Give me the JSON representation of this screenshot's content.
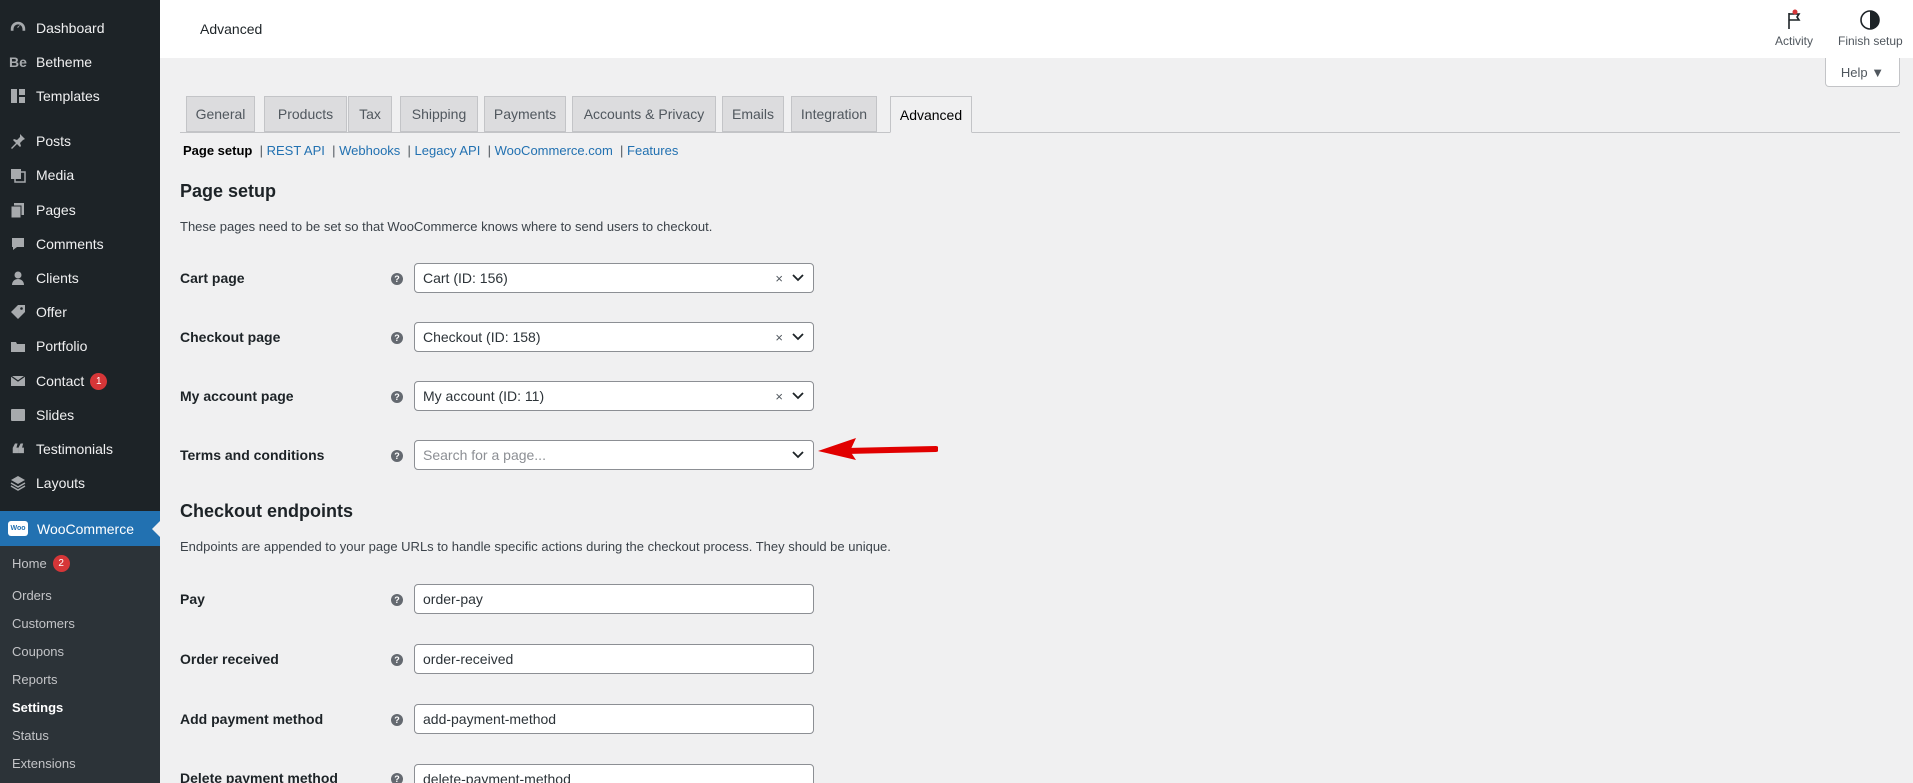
{
  "sidebar": {
    "items": [
      {
        "label": "Dashboard",
        "icon": "dashboard-icon"
      },
      {
        "label": "Betheme",
        "icon": "betheme-icon"
      },
      {
        "label": "Templates",
        "icon": "templates-icon"
      },
      {
        "label": "Posts",
        "icon": "pin-icon"
      },
      {
        "label": "Media",
        "icon": "media-icon"
      },
      {
        "label": "Pages",
        "icon": "pages-icon"
      },
      {
        "label": "Comments",
        "icon": "comments-icon"
      },
      {
        "label": "Clients",
        "icon": "clients-icon"
      },
      {
        "label": "Offer",
        "icon": "tag-icon"
      },
      {
        "label": "Portfolio",
        "icon": "portfolio-icon"
      },
      {
        "label": "Contact",
        "icon": "mail-icon",
        "badge": "1"
      },
      {
        "label": "Slides",
        "icon": "slides-icon"
      },
      {
        "label": "Testimonials",
        "icon": "quote-icon"
      },
      {
        "label": "Layouts",
        "icon": "layouts-icon"
      }
    ],
    "woocommerce": {
      "label": "WooCommerce",
      "logo": "Woo"
    },
    "submenu": [
      {
        "label": "Home",
        "badge": "2"
      },
      {
        "label": "Orders"
      },
      {
        "label": "Customers"
      },
      {
        "label": "Coupons"
      },
      {
        "label": "Reports"
      },
      {
        "label": "Settings",
        "current": true
      },
      {
        "label": "Status"
      },
      {
        "label": "Extensions"
      }
    ]
  },
  "header": {
    "title": "Advanced",
    "activity_label": "Activity",
    "finish_setup_label": "Finish setup",
    "help_label": "Help ▼"
  },
  "tabs": [
    "General",
    "Products",
    "Tax",
    "Shipping",
    "Payments",
    "Accounts & Privacy",
    "Emails",
    "Integration",
    "Advanced"
  ],
  "active_tab": "Advanced",
  "subsections": {
    "current": "Page setup",
    "links": [
      "REST API",
      "Webhooks",
      "Legacy API",
      "WooCommerce.com",
      "Features"
    ]
  },
  "page_setup": {
    "title": "Page setup",
    "description": "These pages need to be set so that WooCommerce knows where to send users to checkout.",
    "rows": [
      {
        "label": "Cart page",
        "value": "Cart (ID: 156)",
        "clearable": true
      },
      {
        "label": "Checkout page",
        "value": "Checkout (ID: 158)",
        "clearable": true
      },
      {
        "label": "My account page",
        "value": "My account (ID: 11)",
        "clearable": true
      },
      {
        "label": "Terms and conditions",
        "placeholder": "Search for a page..."
      }
    ]
  },
  "checkout_endpoints": {
    "title": "Checkout endpoints",
    "description": "Endpoints are appended to your page URLs to handle specific actions during the checkout process. They should be unique.",
    "rows": [
      {
        "label": "Pay",
        "value": "order-pay"
      },
      {
        "label": "Order received",
        "value": "order-received"
      },
      {
        "label": "Add payment method",
        "value": "add-payment-method"
      },
      {
        "label": "Delete payment method",
        "value": "delete-payment-method"
      }
    ]
  },
  "colors": {
    "sidebar_bg": "#1d2327",
    "accent": "#2271b1",
    "badge": "#d63638",
    "annotation_arrow": "#e10000"
  }
}
